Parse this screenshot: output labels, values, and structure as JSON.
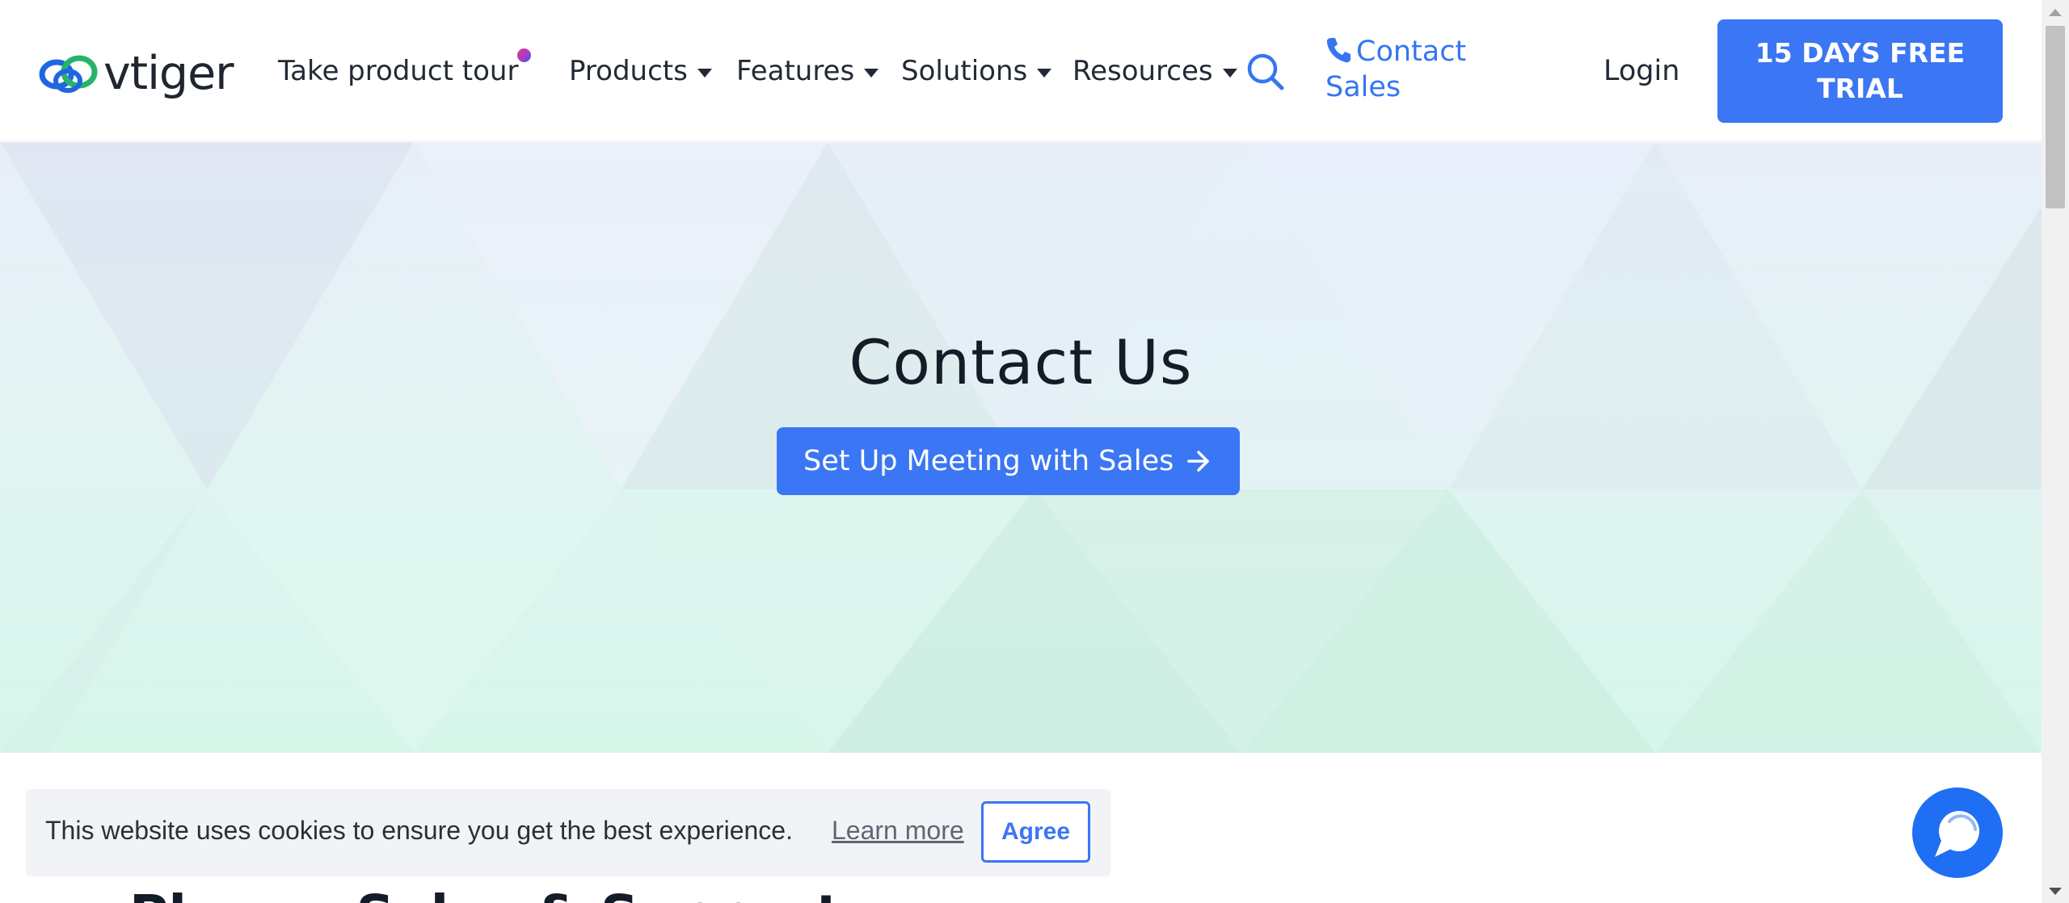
{
  "header": {
    "logo_text": "vtiger",
    "nav": {
      "tour": "Take product tour",
      "products": "Products",
      "features": "Features",
      "solutions": "Solutions",
      "resources": "Resources"
    },
    "contact_sales": "Contact Sales",
    "login": "Login",
    "trial_button": "15 DAYS FREE TRIAL"
  },
  "hero": {
    "title": "Contact Us",
    "meeting_button": "Set Up Meeting with Sales"
  },
  "main": {
    "section_heading": "Phone, Sales & Support"
  },
  "cookie_banner": {
    "text": "This website uses cookies to ensure you get the best experience.",
    "learn_more": "Learn more",
    "agree": "Agree"
  },
  "colors": {
    "accent": "#3b76f4",
    "chat": "#1f6ff4",
    "text_dark": "#141c28"
  },
  "icons": {
    "logo": "vtiger-cloud-logo",
    "search": "search-icon",
    "phone": "phone-icon",
    "arrow": "arrow-right-icon",
    "chat": "chat-bubble-icon"
  }
}
